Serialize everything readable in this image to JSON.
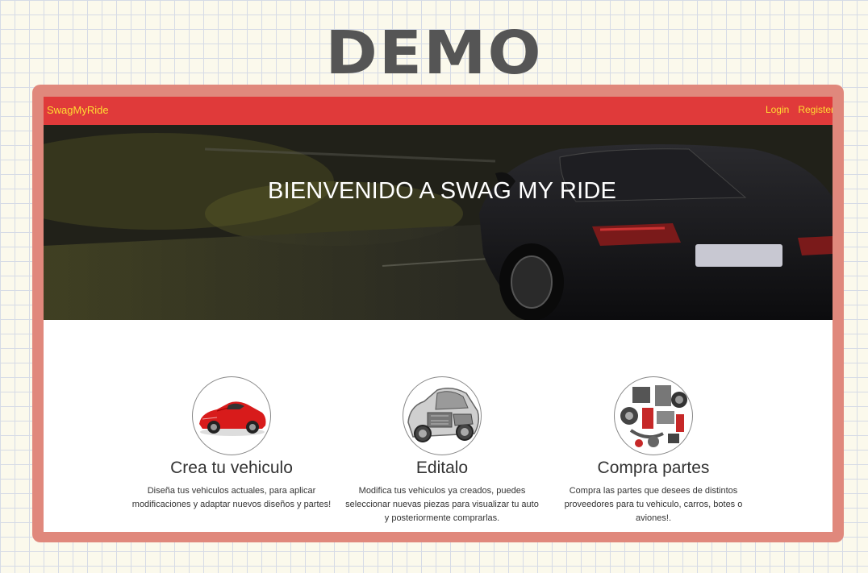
{
  "overlay": {
    "demo_label": "DEMO"
  },
  "navbar": {
    "brand": "SwagMyRide",
    "links": [
      "Login",
      "Register"
    ],
    "background": "#e03a3a",
    "link_color": "#ffdd33"
  },
  "hero": {
    "title": "BIENVENIDO A SWAG MY RIDE"
  },
  "features": [
    {
      "title": "Crea tu vehiculo",
      "description": "Diseña tus vehiculos actuales, para aplicar modificaciones y adaptar nuevos diseños y partes!",
      "icon": "red-sports-car-image"
    },
    {
      "title": "Editalo",
      "description": "Modifica tus vehiculos ya creados, puedes seleccionar nuevas piezas para visualizar tu auto y posteriormente comprarlas.",
      "icon": "car-xray-image"
    },
    {
      "title": "Compra partes",
      "description": "Compra las partes que desees de distintos proveedores para tu vehiculo, carros, botes o aviones!.",
      "icon": "car-parts-image"
    }
  ]
}
